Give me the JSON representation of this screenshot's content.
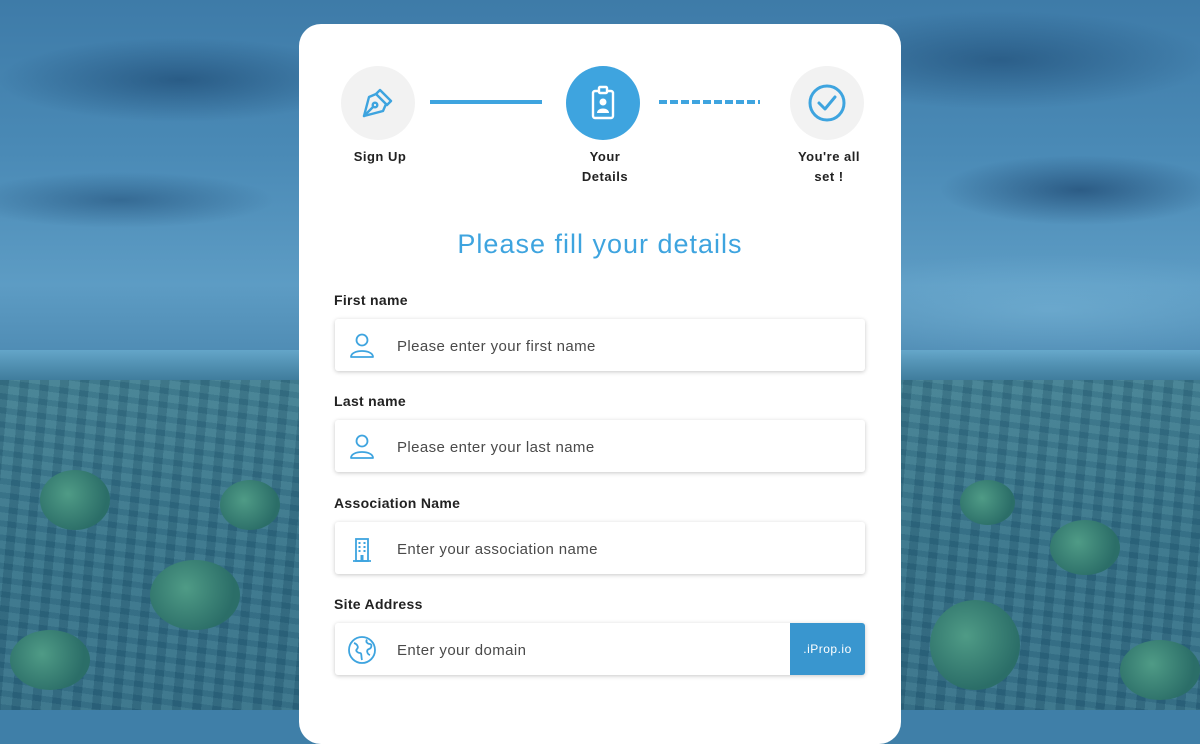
{
  "stepper": {
    "steps": [
      {
        "label": "Sign Up",
        "icon": "pen-nib-icon",
        "state": "done"
      },
      {
        "label_line1": "Your",
        "label_line2": "Details",
        "icon": "id-badge-icon",
        "state": "active"
      },
      {
        "label_line1": "You're all",
        "label_line2": "set !",
        "icon": "check-circle-icon",
        "state": "pending"
      }
    ]
  },
  "form": {
    "heading": "Please fill your details",
    "fields": [
      {
        "label": "First name",
        "placeholder": "Please enter your first name",
        "icon": "user-icon"
      },
      {
        "label": "Last name",
        "placeholder": "Please enter your last name",
        "icon": "user-icon"
      },
      {
        "label": "Association Name",
        "placeholder": "Enter your association name",
        "icon": "building-icon"
      },
      {
        "label": "Site Address",
        "placeholder": "Enter your domain",
        "icon": "globe-icon",
        "suffix": ".iProp.io"
      }
    ]
  },
  "colors": {
    "accent": "#3ea4df",
    "suffix_bg": "#3996cf",
    "inactive_circle": "#f2f2f2"
  }
}
